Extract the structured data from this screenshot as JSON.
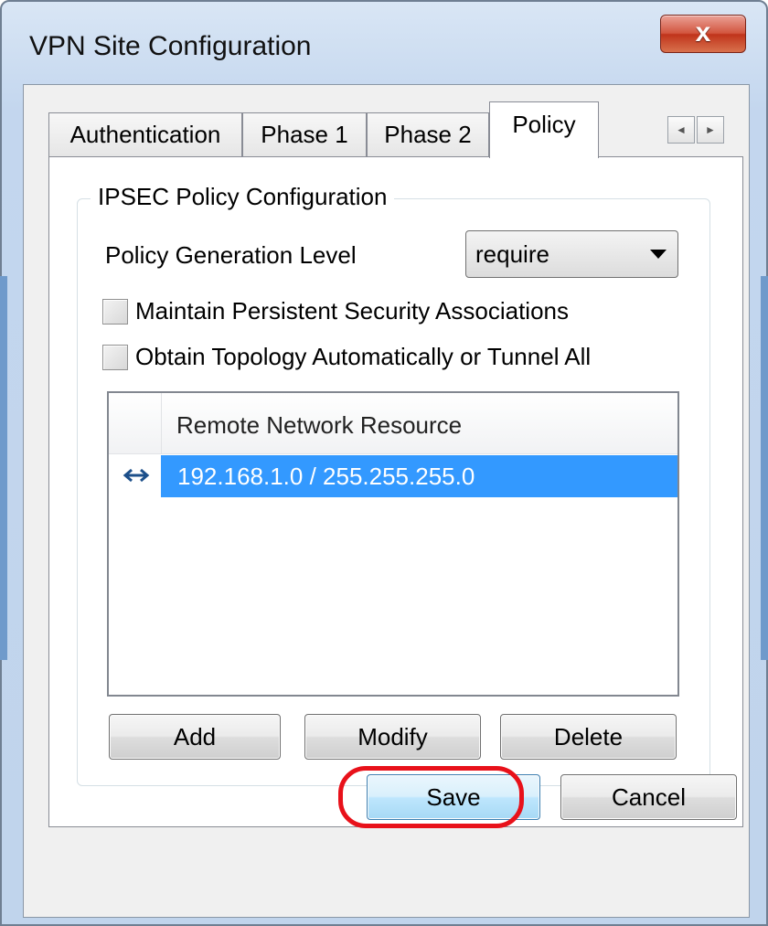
{
  "window": {
    "title": "VPN Site Configuration",
    "close_icon": "close-icon",
    "close_glyph": "x"
  },
  "tabs": [
    {
      "label": "Authentication",
      "active": false
    },
    {
      "label": "Phase 1",
      "active": false
    },
    {
      "label": "Phase 2",
      "active": false
    },
    {
      "label": "Policy",
      "active": true
    }
  ],
  "tab_scroll": {
    "left_glyph": "◄",
    "right_glyph": "►"
  },
  "group": {
    "legend": "IPSEC Policy Configuration",
    "policy_level": {
      "label": "Policy Generation Level",
      "value": "require"
    },
    "checkboxes": [
      {
        "label": "Maintain Persistent Security Associations",
        "checked": false
      },
      {
        "label": "Obtain Topology Automatically or Tunnel All",
        "checked": false
      }
    ],
    "list": {
      "column_header": "Remote Network Resource",
      "rows": [
        {
          "icon": "bidirectional-arrow-icon",
          "value": "192.168.1.0 / 255.255.255.0",
          "selected": true
        }
      ]
    },
    "buttons": {
      "add": "Add",
      "modify": "Modify",
      "delete": "Delete"
    }
  },
  "footer": {
    "save": "Save",
    "cancel": "Cancel"
  },
  "colors": {
    "selection": "#3399ff",
    "highlight_ring": "#e8111a",
    "close_button": "#c0341b"
  }
}
